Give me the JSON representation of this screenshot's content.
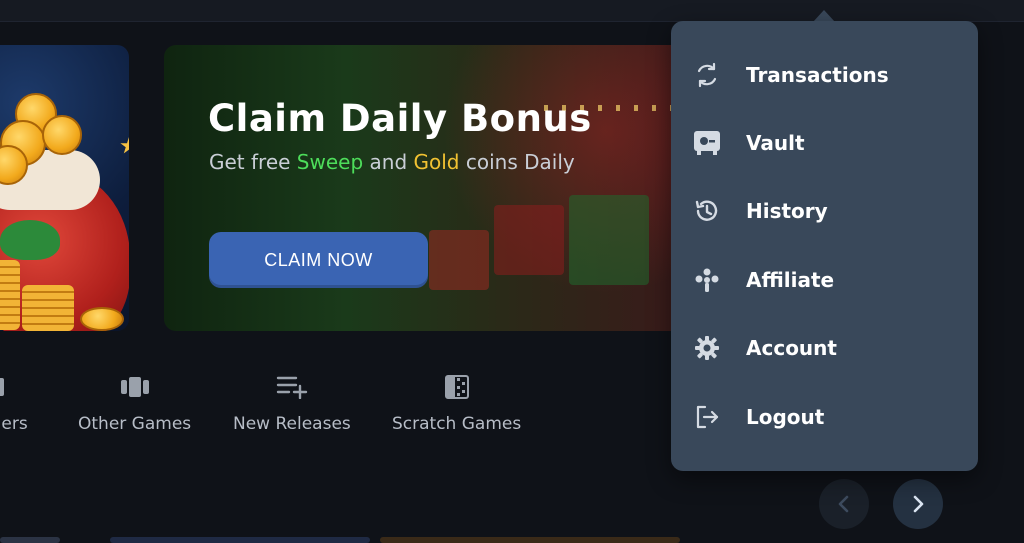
{
  "banner": {
    "title": "Claim Daily Bonus",
    "subtitle_prefix": "Get free ",
    "subtitle_sweep": "Sweep",
    "subtitle_middle": " and ",
    "subtitle_gold": "Gold",
    "subtitle_suffix": " coins Daily",
    "cta_label": "CLAIM NOW",
    "colors": {
      "cta": "#3a64b3",
      "sweep": "#4ddd5a",
      "gold": "#f1c232"
    }
  },
  "categories": [
    {
      "label": "alers",
      "icon": "live-dealer-icon"
    },
    {
      "label": "Other Games",
      "icon": "other-games-icon"
    },
    {
      "label": "New Releases",
      "icon": "new-releases-icon"
    },
    {
      "label": "Scratch Games",
      "icon": "scratch-games-icon"
    }
  ],
  "menu": {
    "background": "#39485a",
    "items": [
      {
        "label": "Transactions",
        "icon": "transactions-icon"
      },
      {
        "label": "Vault",
        "icon": "vault-icon"
      },
      {
        "label": "History",
        "icon": "history-icon"
      },
      {
        "label": "Affiliate",
        "icon": "affiliate-icon"
      },
      {
        "label": "Account",
        "icon": "gear-icon"
      },
      {
        "label": "Logout",
        "icon": "logout-icon"
      }
    ]
  },
  "pager": {
    "prev_icon": "chevron-left-icon",
    "next_icon": "chevron-right-icon"
  }
}
